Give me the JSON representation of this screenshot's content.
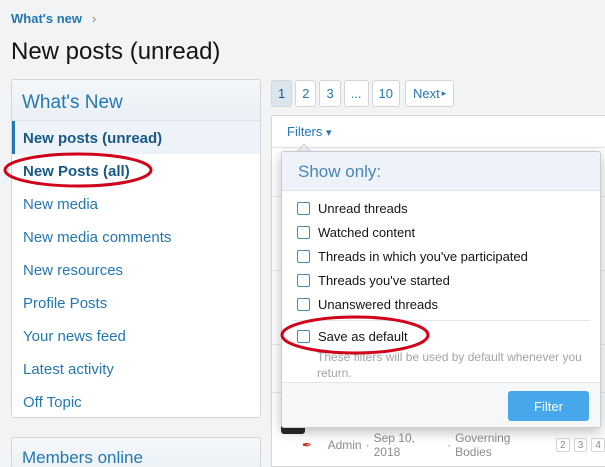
{
  "breadcrumb": {
    "label": "What's new",
    "chevron": "›"
  },
  "page_title": "New posts (unread)",
  "sidebar": {
    "heading": "What's New",
    "items": [
      {
        "label": "New posts (unread)",
        "active": true
      },
      {
        "label": "New Posts (all)"
      },
      {
        "label": "New media"
      },
      {
        "label": "New media comments"
      },
      {
        "label": "New resources"
      },
      {
        "label": "Profile Posts"
      },
      {
        "label": "Your news feed"
      },
      {
        "label": "Latest activity"
      },
      {
        "label": "Off Topic"
      }
    ]
  },
  "members_online": {
    "heading": "Members online"
  },
  "pagination": {
    "pages": [
      "1",
      "2",
      "3",
      "...",
      "10"
    ],
    "current": "1",
    "next_label": "Next",
    "next_icon": "▸"
  },
  "filter_bar": {
    "label": "Filters",
    "icon": "▾"
  },
  "filter_popup": {
    "heading": "Show only:",
    "options": [
      "Unread threads",
      "Watched content",
      "Threads in which you've participated",
      "Threads you've started",
      "Unanswered threads"
    ],
    "save_default_label": "Save as default",
    "hint": "These filters will be used by default whenever you return.",
    "submit_label": "Filter"
  },
  "thread_row": {
    "author": "Admin",
    "dot1": "·",
    "date": "Sep 10, 2018",
    "dot2": "·",
    "forum": "Governing Bodies",
    "pages": [
      "2",
      "3",
      "4"
    ]
  },
  "colors": {
    "link": "#2577b1",
    "accent_button": "#47a7eb",
    "annotation": "#d0021b"
  }
}
